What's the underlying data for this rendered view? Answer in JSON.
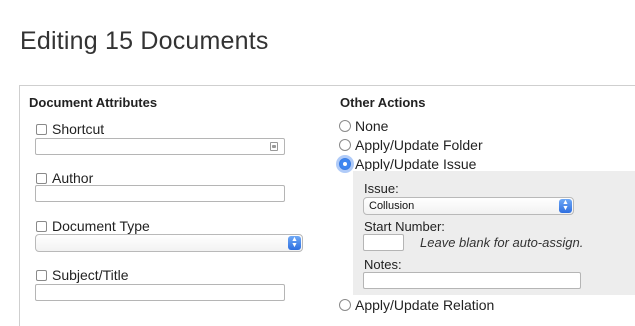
{
  "page": {
    "title": "Editing 15 Documents"
  },
  "attributes": {
    "heading": "Document Attributes",
    "fields": [
      {
        "label": "Shortcut",
        "value": ""
      },
      {
        "label": "Author",
        "value": ""
      },
      {
        "label": "Document Type",
        "value": ""
      },
      {
        "label": "Subject/Title",
        "value": ""
      }
    ]
  },
  "actions": {
    "heading": "Other Actions",
    "options": [
      {
        "label": "None",
        "selected": false
      },
      {
        "label": "Apply/Update Folder",
        "selected": false
      },
      {
        "label": "Apply/Update Issue",
        "selected": true
      },
      {
        "label": "Apply/Update Relation",
        "selected": false
      }
    ],
    "issue": {
      "issue_label": "Issue:",
      "issue_value": "Collusion",
      "start_number_label": "Start Number:",
      "start_number_value": "",
      "start_number_hint": "Leave blank for auto-assign.",
      "notes_label": "Notes:",
      "notes_value": ""
    }
  },
  "colors": {
    "accent": "#3f86f0",
    "panel_bg": "#ededed",
    "border": "#cfcfcf"
  }
}
